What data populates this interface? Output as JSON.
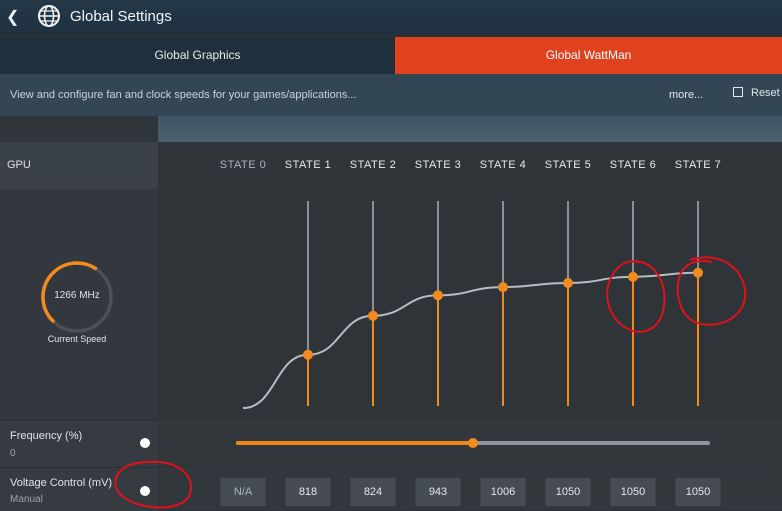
{
  "header": {
    "back_icon": "chevron-left-icon",
    "globe_icon": "globe-icon",
    "title": "Global Settings"
  },
  "tabs": [
    {
      "label": "Global Graphics",
      "active": false
    },
    {
      "label": "Global WattMan",
      "active": true
    }
  ],
  "info": {
    "text": "View and configure fan and clock speeds for your games/applications...",
    "more_label": "more...",
    "reset_label": "Reset",
    "reset_icon": "reset-icon"
  },
  "gpu": {
    "label": "GPU",
    "states": [
      "STATE 0",
      "STATE 1",
      "STATE 2",
      "STATE 3",
      "STATE 4",
      "STATE 5",
      "STATE 6",
      "STATE 7"
    ],
    "gauge": {
      "value": "1266 MHz",
      "caption": "Current Speed",
      "fill": 0.62
    }
  },
  "frequency": {
    "label": "Frequency (%)",
    "value": "0",
    "slider_fraction": 0.5
  },
  "voltage": {
    "label": "Voltage Control (mV)",
    "mode": "Manual",
    "values": [
      "N/A",
      "818",
      "824",
      "943",
      "1006",
      "1050",
      "1050",
      "1050"
    ]
  },
  "chart_data": {
    "type": "line",
    "series": [
      {
        "name": "",
        "values": [
          null,
          0.25,
          0.44,
          0.54,
          0.58,
          0.6,
          0.63,
          0.65
        ]
      }
    ],
    "categories": [
      "STATE 0",
      "STATE 1",
      "STATE 2",
      "STATE 3",
      "STATE 4",
      "STATE 5",
      "STATE 6",
      "STATE 7"
    ],
    "ylim": [
      0,
      1
    ]
  },
  "colors": {
    "accent": "#f28a1f",
    "tab_active": "#e0421e",
    "annotation": "#e0101a"
  }
}
